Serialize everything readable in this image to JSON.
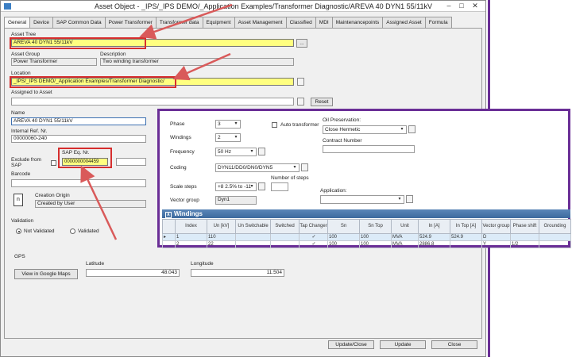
{
  "window": {
    "title": "Asset Object - _IPS/_IPS DEMO/_Application Examples/Transformer Diagnostic/AREVA 40 DYN1 55/11kV",
    "minimize": "–",
    "maximize": "□",
    "close": "✕"
  },
  "tabs": [
    "General",
    "Device",
    "SAP Common Data",
    "Power Transformer",
    "Transformer data",
    "Equipment",
    "Asset Management",
    "Classified",
    "MDI",
    "Maintenancepoints",
    "Assigned Asset",
    "Formula"
  ],
  "general": {
    "asset_tree_label": "Asset Tree",
    "asset_tree_value": "AREVA 40 DYN1 55/11kV",
    "asset_group_label": "Asset Group",
    "asset_group_value": "Power Transformer",
    "description_label": "Description",
    "description_value": "Two winding transformer",
    "location_label": "Location",
    "location_value": "_IPS/_IPS DEMO/_Application Examples/Transformer Diagnostic/",
    "assigned_label": "Assigned to Asset",
    "reset_label": "Reset",
    "browse": "...",
    "name_label": "Name",
    "name_value": "AREVA 40 DYN1 55/11kV",
    "internal_ref_label": "Internal Ref. Nr.",
    "internal_ref_value": "00000060-240",
    "sap_label": "SAP Eq. Nr.",
    "sap_value": "0000000004459",
    "exclude_label_1": "Exclude from",
    "exclude_label_2": "SAP",
    "barcode_label": "Barcode",
    "creation_origin_label": "Creation Origin",
    "creation_origin_value": "Created by User",
    "origin_box": "n",
    "validation_label": "Validation",
    "not_validated": "Not Validated",
    "validated": "Validated",
    "gps_label": "GPS",
    "view_maps": "View in Google Maps",
    "latitude_label": "Latitude",
    "latitude_value": "48.043",
    "longitude_label": "Longitude",
    "longitude_value": "11.504"
  },
  "footer": {
    "update_close": "Update/Close",
    "update": "Update",
    "close": "Close"
  },
  "transformer_data": {
    "phase_label": "Phase",
    "phase_value": "3",
    "windings_label": "Windings",
    "windings_value": "2",
    "frequency_label": "Frequency",
    "frequency_value": "50 Hz",
    "coding_label": "Coding",
    "coding_value": "DYN11/DD0/DN0/DYN5",
    "scale_steps_label": "Scale steps",
    "scale_steps_value": "+8 2.5% to -11",
    "number_steps_label": "Number of steps",
    "vector_group_label": "Vector group",
    "vector_group_value": "Dyn1",
    "auto_transformer_label": "Auto transformer",
    "oil_preservation_label": "Oil Preservation:",
    "oil_preservation_value": "Close Hermetic",
    "contract_number_label": "Contract Number",
    "application_label": "Application:"
  },
  "windings": {
    "title": "Windings",
    "columns": [
      "",
      "Index",
      "Un [kV]",
      "Un Switchable",
      "Switched",
      "Tap Changer",
      "Sn",
      "Sn Top",
      "Unit",
      "In [A]",
      "In Top [A]",
      "Vector group",
      "Phase shift",
      "Grounding"
    ],
    "rows": [
      [
        "▸",
        "1",
        "110",
        "",
        "",
        "✓",
        "100",
        "100",
        "MVA",
        "524.9",
        "524.9",
        "D",
        "",
        ""
      ],
      [
        "",
        "2",
        "22",
        "",
        "",
        "✓",
        "100",
        "100",
        "MVA",
        "2886.8",
        "",
        "Y",
        "1/2",
        ""
      ]
    ]
  },
  "colors": {
    "highlight_box": "#d62e2e",
    "overlay_border": "#6a2e96",
    "field_highlight": "#ffff80",
    "grid_header": "#3d6a9e"
  }
}
